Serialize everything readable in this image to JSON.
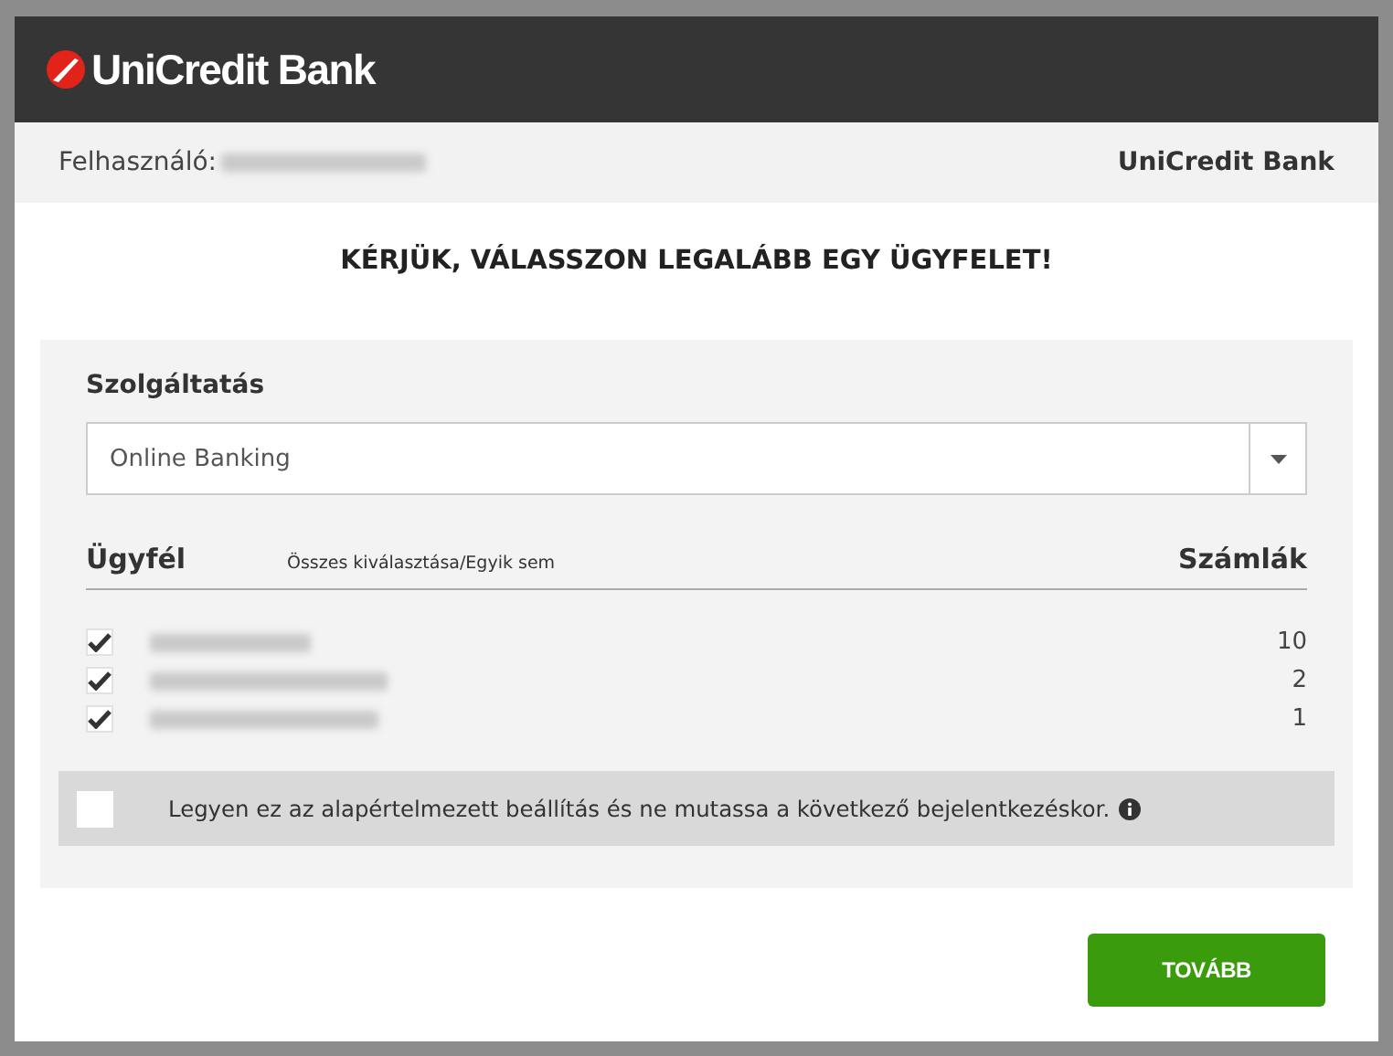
{
  "header": {
    "logo_text": "UniCredit Bank"
  },
  "user_bar": {
    "label": "Felhasználó:",
    "bank_name": "UniCredit Bank"
  },
  "heading": "KÉRJÜK, VÁLASSZON LEGALÁBB EGY ÜGYFELET!",
  "service": {
    "label": "Szolgáltatás",
    "value": "Online Banking"
  },
  "clients": {
    "column_client": "Ügyfél",
    "select_all_link": "Összes kiválasztása/Egyik sem",
    "column_accounts": "Számlák",
    "rows": [
      {
        "checked": true,
        "accounts": "10"
      },
      {
        "checked": true,
        "accounts": "2"
      },
      {
        "checked": true,
        "accounts": "1"
      }
    ]
  },
  "default_option": {
    "checked": false,
    "text": "Legyen ez az alapértelmezett beállítás és ne mutassa a következő bejelentkezéskor."
  },
  "buttons": [
    {
      "label": "TOVÁBB"
    }
  ]
}
